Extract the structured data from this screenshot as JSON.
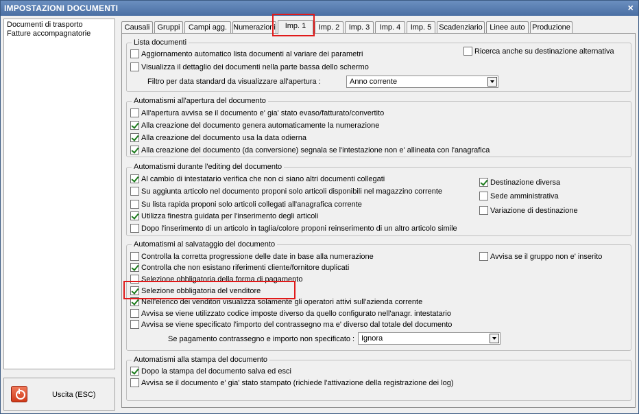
{
  "window": {
    "title": "IMPOSTAZIONI DOCUMENTI",
    "close_glyph": "×"
  },
  "doc_list": {
    "items": [
      "Documenti di trasporto",
      "Fatture accompagnatorie"
    ]
  },
  "exit": {
    "label": "Uscita (ESC)",
    "icon": "power-icon"
  },
  "tabs": [
    {
      "label": "Causali"
    },
    {
      "label": "Gruppi"
    },
    {
      "label": "Campi agg."
    },
    {
      "label": "Numerazioni"
    },
    {
      "label": "Imp. 1",
      "active": true
    },
    {
      "label": "Imp. 2"
    },
    {
      "label": "Imp. 3"
    },
    {
      "label": "Imp. 4"
    },
    {
      "label": "Imp. 5"
    },
    {
      "label": "Scadenziario"
    },
    {
      "label": "Linee auto"
    },
    {
      "label": "Produzione"
    }
  ],
  "groups": {
    "lista": {
      "title": "Lista documenti",
      "items": [
        {
          "label": "Aggiornamento automatico lista documenti al variare dei parametri",
          "checked": false
        },
        {
          "label": "Visualizza il dettaglio dei documenti nella parte bassa dello schermo",
          "checked": false
        },
        {
          "label": "Ricerca anche su destinazione alternativa",
          "checked": false
        }
      ],
      "filter_label": "Filtro per data standard da visualizzare all'apertura :",
      "filter_value": "Anno corrente"
    },
    "apertura": {
      "title": "Automatismi all'apertura del documento",
      "items": [
        {
          "label": "All'apertura avvisa se il documento e' gia' stato evaso/fatturato/convertito",
          "checked": false
        },
        {
          "label": "Alla creazione del documento genera automaticamente la numerazione",
          "checked": true
        },
        {
          "label": "Alla creazione del documento usa la data odierna",
          "checked": true
        },
        {
          "label": "Alla creazione del documento (da conversione) segnala se l'intestazione non e' allineata con l'anagrafica",
          "checked": true
        }
      ]
    },
    "editing": {
      "title": "Automatismi durante l'editing del documento",
      "items": [
        {
          "label": "Al cambio di intestatario verifica che non ci siano altri documenti collegati",
          "checked": true
        },
        {
          "label": "Su aggiunta articolo nel documento proponi solo articoli disponibili nel magazzino corrente",
          "checked": false
        },
        {
          "label": "Su lista rapida proponi solo articoli collegati all'anagrafica corrente",
          "checked": false
        },
        {
          "label": "Utilizza finestra guidata per l'inserimento degli articoli",
          "checked": true
        },
        {
          "label": "Dopo l'inserimento di un articolo in taglia/colore proponi reinserimento di un altro articolo simile",
          "checked": false
        }
      ],
      "side_items": [
        {
          "label": "Destinazione diversa",
          "checked": true
        },
        {
          "label": "Sede amministrativa",
          "checked": false
        },
        {
          "label": "Variazione di destinazione",
          "checked": false
        }
      ]
    },
    "salvataggio": {
      "title": "Automatismi al salvataggio del documento",
      "items": [
        {
          "label": "Controlla la corretta progressione delle date in base alla numerazione",
          "checked": false
        },
        {
          "label": "Controlla che non esistano riferimenti cliente/fornitore duplicati",
          "checked": true
        },
        {
          "label": "Selezione obbligatoria della forma di pagamento",
          "checked": false
        },
        {
          "label": "Selezione obbligatoria del venditore",
          "checked": true
        },
        {
          "label": "Nell'elenco dei venditori visualizza solamente gli operatori attivi sull'azienda corrente",
          "checked": true
        },
        {
          "label": "Avvisa se viene utilizzato codice imposte diverso da quello configurato nell'anagr. intestatario",
          "checked": false
        },
        {
          "label": "Avvisa se viene specificato l'importo del contrassegno ma e' diverso dal totale del documento",
          "checked": false
        }
      ],
      "side_item": {
        "label": "Avvisa se il gruppo non e' inserito",
        "checked": false
      },
      "payment_label": "Se pagamento contrassegno e importo non specificato :",
      "payment_value": "Ignora"
    },
    "stampa": {
      "title": "Automatismi alla stampa del documento",
      "items": [
        {
          "label": "Dopo la stampa del documento salva ed esci",
          "checked": true
        },
        {
          "label": "Avvisa se il documento e' gia' stato stampato (richiede l'attivazione della registrazione dei log)",
          "checked": false
        }
      ]
    }
  },
  "colors": {
    "title_bar": "#4a6fa3",
    "highlight": "#e01a1a",
    "check": "#1a7a1a"
  }
}
